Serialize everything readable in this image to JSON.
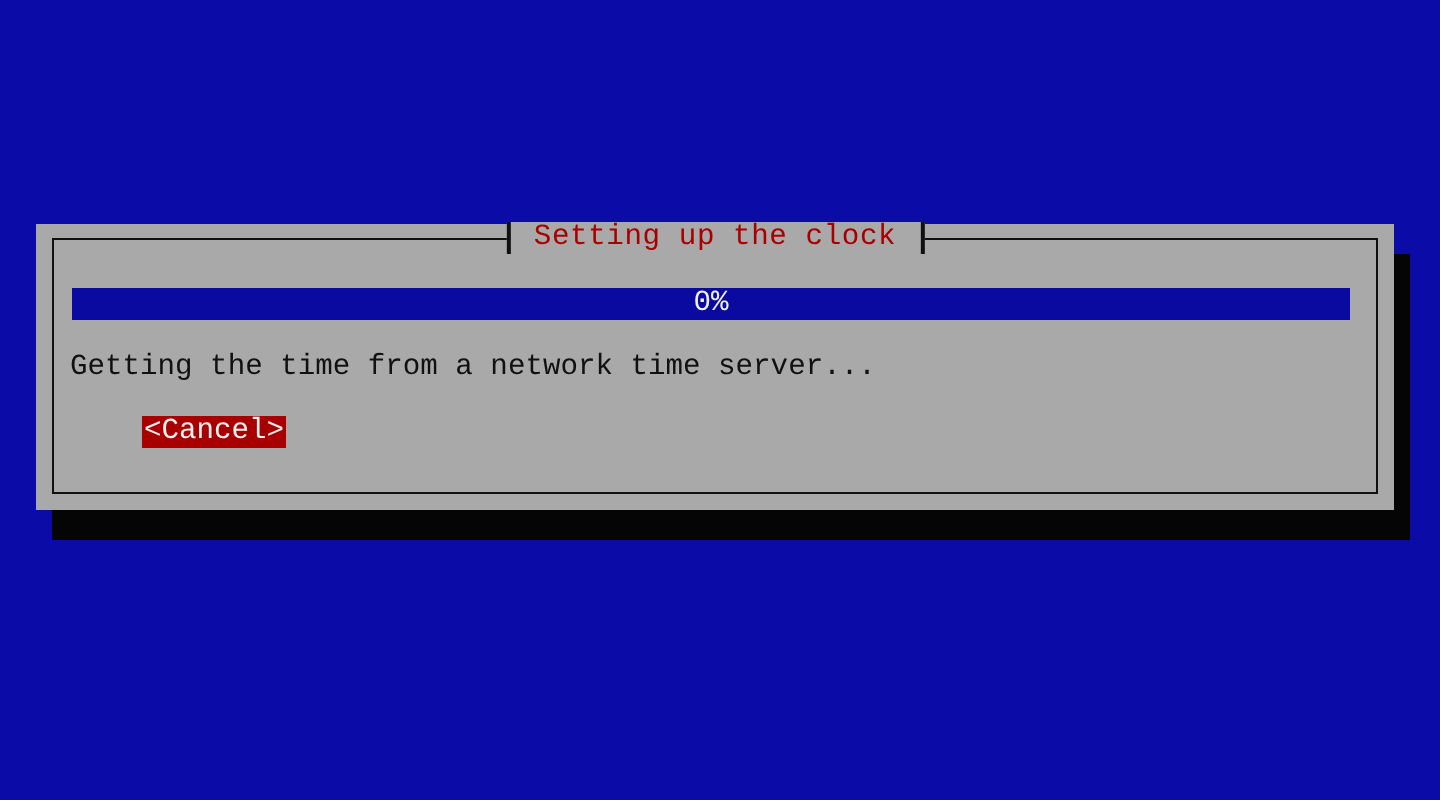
{
  "dialog": {
    "title": "Setting up the clock",
    "progress": {
      "level": 0,
      "reading": "0%"
    },
    "message": "Getting the time from a network time server...",
    "buttons": [
      {
        "label": "<Cancel>",
        "selected": true
      }
    ]
  }
}
